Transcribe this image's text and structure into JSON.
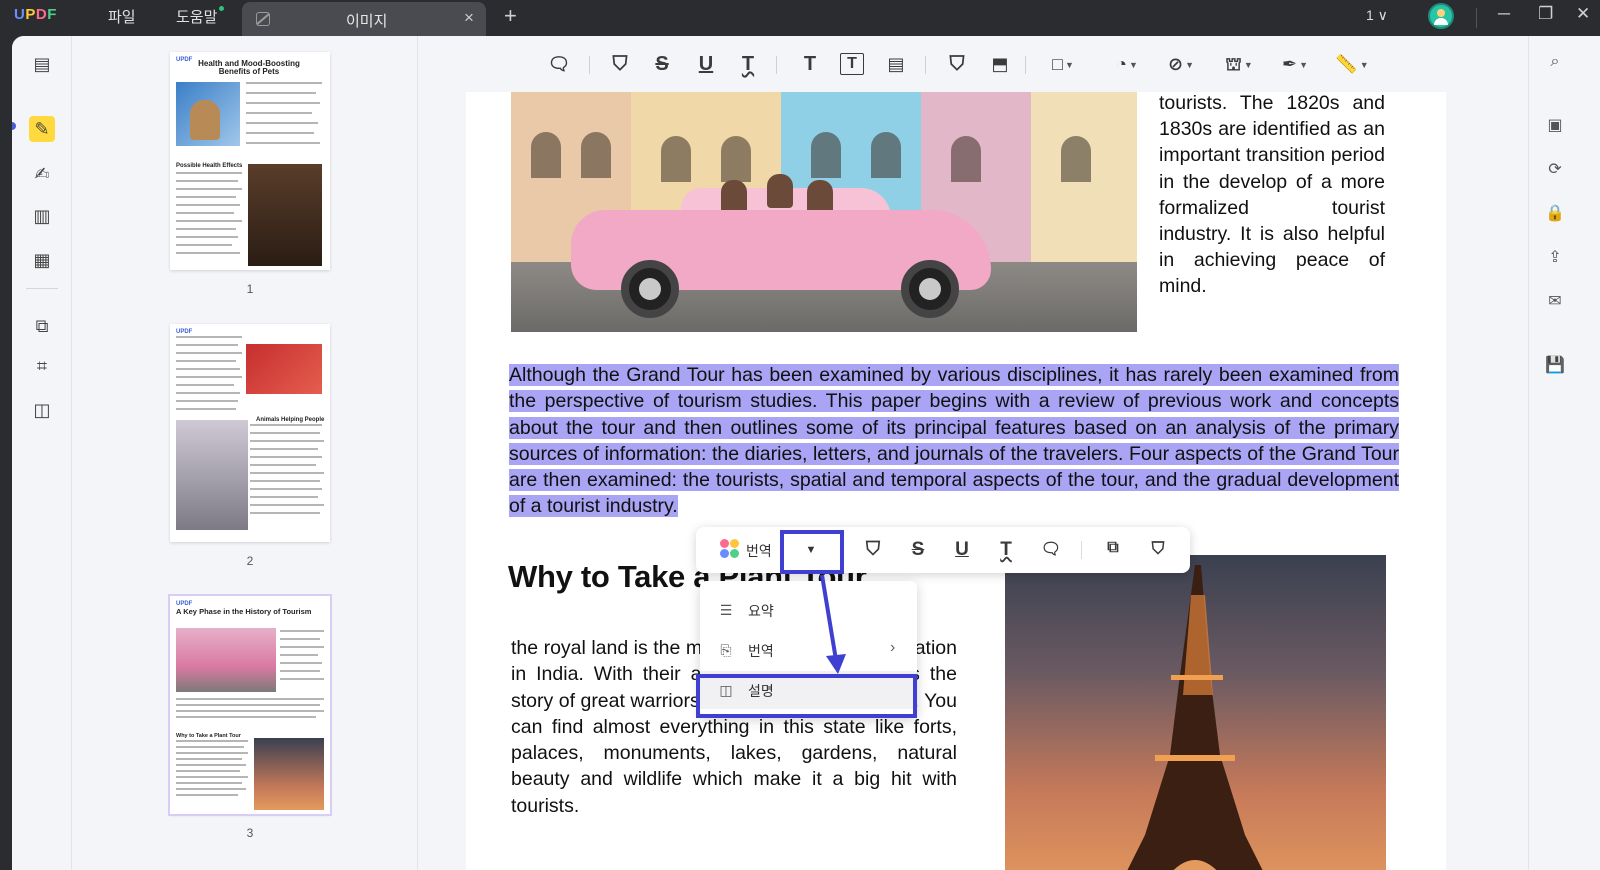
{
  "app": {
    "logo": "UPDF",
    "menu": [
      "파일",
      "도움말"
    ],
    "tab_title": "이미지",
    "tab_close": "×",
    "tab_add": "+",
    "page_count": "1 ∨",
    "window_buttons": [
      "─",
      "❐",
      "✕"
    ]
  },
  "thumbnails": [
    {
      "number": "1",
      "title": "Health and Mood-Boosting Benefits of Pets",
      "sub_heading": "Possible Health Effects"
    },
    {
      "number": "2",
      "title": "",
      "sub_heading": "Animals Helping People"
    },
    {
      "number": "3",
      "title": "A Key Phase in the History of Tourism",
      "sub_heading": "Why to Take a Plant Tour"
    }
  ],
  "document": {
    "side_text": "tourists. The 1820s and 1830s are identified as an important transition period in the develop of a more formalized tourist industry. It is also helpful in achieving peace of mind.",
    "selected_paragraph": "Although the Grand Tour has been examined by various disciplines, it has rarely been examined from the perspective of tourism studies. This paper begins with a review of previous work and concepts about the tour and then outlines some of its principal features based on an analysis of the primary sources of information: the diaries, letters, and journals of the travelers. Four aspects of the Grand Tour are then examined: the tourists, spatial and temporal aspects of the tour, and the gradual development of a tourist industry.",
    "heading": "Why to Take a Plant Tour",
    "paragraph2": "the royal land is the most popular tourist destination in India. With their attractions, the state tells the story of great warriors who ruled over the state. You can find almost everything in this state like forts, palaces, monuments, lakes, gardens, natural beauty and wildlife which make it a big hit with tourists."
  },
  "float_toolbar": {
    "ai_label": "번역",
    "dropdown_glyph": "▼"
  },
  "dropdown_menu": {
    "items": [
      {
        "icon": "list-icon",
        "label": "요약"
      },
      {
        "icon": "translate-icon",
        "label": "번역",
        "has_submenu": true
      },
      {
        "icon": "explain-icon",
        "label": "설명"
      }
    ],
    "submenu_glyph": "›"
  },
  "colors": {
    "highlight": "#a9a4f3",
    "annotation": "#3f3fd1",
    "active_tool": "#ffd93d",
    "titlebar": "#2b2c30"
  }
}
